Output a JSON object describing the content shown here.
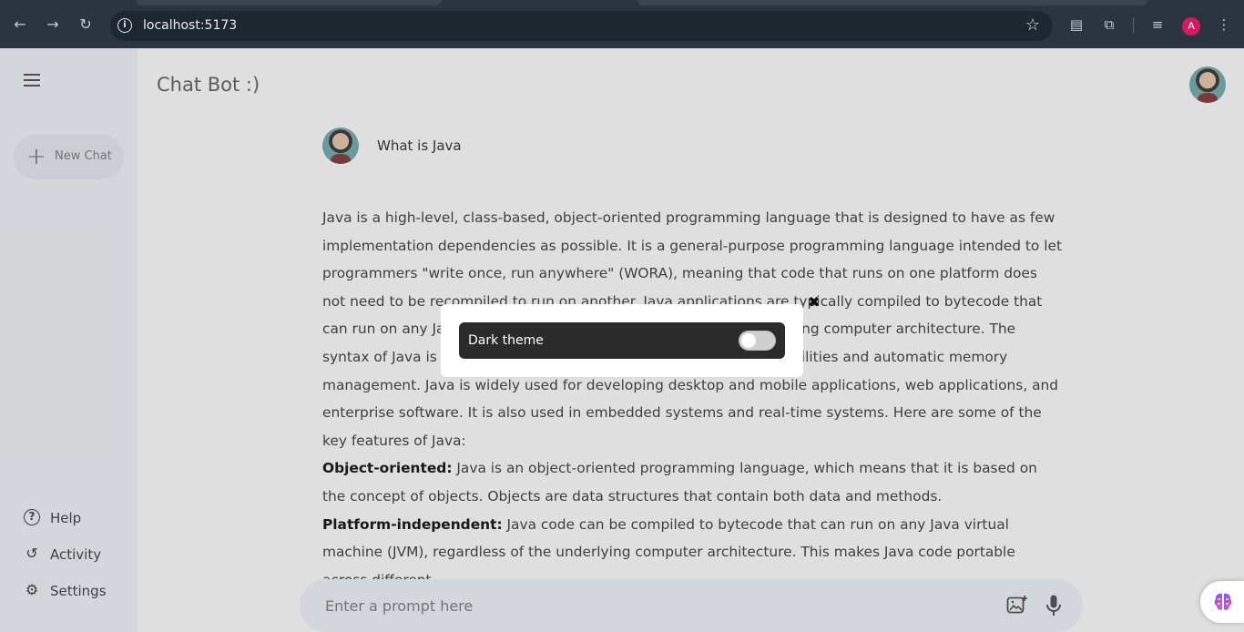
{
  "browser": {
    "url": "localhost:5173",
    "profile_initial": "A"
  },
  "sidebar": {
    "new_chat_label": "New Chat",
    "bottom_items": [
      {
        "label": "Help",
        "icon": "help-icon"
      },
      {
        "label": "Activity",
        "icon": "history-icon"
      },
      {
        "label": "Settings",
        "icon": "gear-icon"
      }
    ]
  },
  "header": {
    "title": "Chat Bot :)"
  },
  "chat": {
    "question": "What is Java",
    "answer": {
      "intro": "Java is a high-level, class-based, object-oriented programming language that is designed to have as few implementation dependencies as possible. It is a general-purpose programming language intended to let programmers \"write once, run anywhere\" (WORA), meaning that code that runs on one platform does not need to be recompiled to run on another. Java applications are typically compiled to bytecode that can run on any Java virtual machine (JVM) regardless of the underlying computer architecture. The syntax of Java is similar to C and C++, but it has fewer low-level facilities and automatic memory management. Java is widely used for developing desktop and mobile applications, web applications, and enterprise software. It is also used in embedded systems and real-time systems. Here are some of the key features of Java:",
      "features": [
        {
          "title": "Object-oriented:",
          "text": " Java is an object-oriented programming language, which means that it is based on the concept of objects. Objects are data structures that contain both data and methods."
        },
        {
          "title": "Platform-independent:",
          "text": " Java code can be compiled to bytecode that can run on any Java virtual machine (JVM), regardless of the underlying computer architecture. This makes Java code portable across different"
        }
      ]
    }
  },
  "prompt": {
    "placeholder": "Enter a prompt here"
  },
  "modal": {
    "dark_theme_label": "Dark theme",
    "dark_theme_on": false
  },
  "colors": {
    "browser_bar": "#2b3440",
    "sidebar_bg": "#f0f4f9",
    "modal_row_bg": "#2b2b2b",
    "profile_badge": "#d21a61"
  }
}
